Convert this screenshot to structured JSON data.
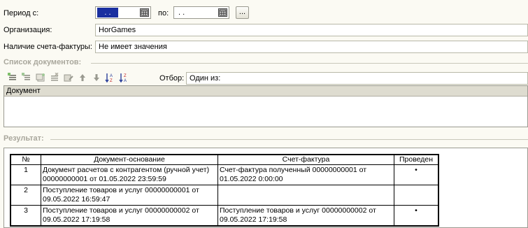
{
  "filters": {
    "period_from_label": "Период с:",
    "period_from_value": ". .",
    "period_to_label": "по:",
    "period_to_value": ". .",
    "period_button": "...",
    "organization_label": "Организация:",
    "organization_value": "HorGames",
    "invoice_label": "Наличие счета-фактуры:",
    "invoice_value": "Не имеет значения"
  },
  "documents_section": {
    "title": "Список документов:",
    "filter_label": "Отбор:",
    "filter_value": "Один из:",
    "list_header": "Документ"
  },
  "result_section": {
    "title": "Результат:",
    "columns": [
      "№",
      "Документ-основание",
      "Счет-фактура",
      "Проведен"
    ],
    "rows": [
      {
        "n": "1",
        "base": "Документ расчетов с контрагентом (ручной учет) 00000000001 от 01.05.2022 23:59:59",
        "invoice": "Счет-фактура полученный 00000000001 от 01.05.2022 0:00:00",
        "posted": "•"
      },
      {
        "n": "2",
        "base": "Поступление товаров и услуг 00000000001 от 09.05.2022 16:59:47",
        "invoice": "",
        "posted": ""
      },
      {
        "n": "3",
        "base": "Поступление товаров и услуг 00000000002 от 09.05.2022 17:19:58",
        "invoice": "Поступление товаров и услуг 00000000002 от 09.05.2022 17:19:58",
        "posted": "•"
      }
    ]
  },
  "icons": {
    "toolbar": [
      "add-row-icon",
      "add-group-icon",
      "copy-row-icon",
      "delete-row-icon",
      "edit-row-icon",
      "move-up-icon",
      "move-down-icon",
      "sort-asc-icon",
      "sort-desc-icon"
    ]
  }
}
